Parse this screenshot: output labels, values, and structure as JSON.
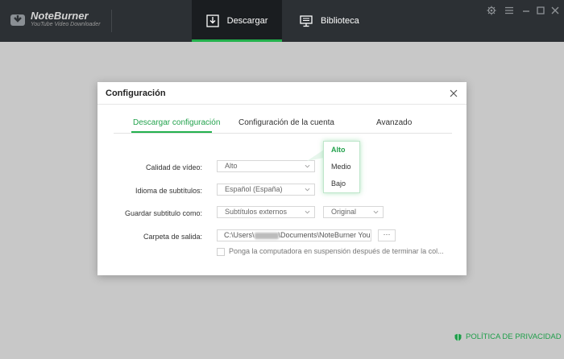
{
  "app": {
    "name": "NoteBurner",
    "subtitle": "YouTube Video Downloader"
  },
  "nav": {
    "download": "Descargar",
    "library": "Biblioteca"
  },
  "window_controls": [
    "gear-icon",
    "menu-icon",
    "minimize-icon",
    "maximize-icon",
    "close-icon"
  ],
  "privacy": "POLÍTICA DE PRIVACIDAD",
  "dialog": {
    "title": "Configuración",
    "tabs": [
      "Descargar configuración",
      "Configuración de la cuenta",
      "Avanzado"
    ],
    "fields": {
      "quality_label": "Calidad de vídeo:",
      "quality_value": "Alto",
      "subtitle_lang_label": "Idioma de subtítulos:",
      "subtitle_lang_value": "Español (España)",
      "save_subtitle_label": "Guardar subtitulo como:",
      "save_subtitle_value": "Subtítulos externos",
      "save_subtitle_mode": "Original",
      "output_label": "Carpeta de salida:",
      "output_path_prefix": "C:\\Users\\",
      "output_path_suffix": "\\Documents\\NoteBurner You",
      "browse": "···",
      "sleep_label": "Ponga la computadora en suspensión después de terminar la col..."
    },
    "quality_options": [
      "Alto",
      "Medio",
      "Bajo"
    ]
  },
  "colors": {
    "accent": "#23b14d",
    "topbar": "#2c3034",
    "active_tab": "#1a1d20",
    "overlay": "#c8c8c8"
  }
}
